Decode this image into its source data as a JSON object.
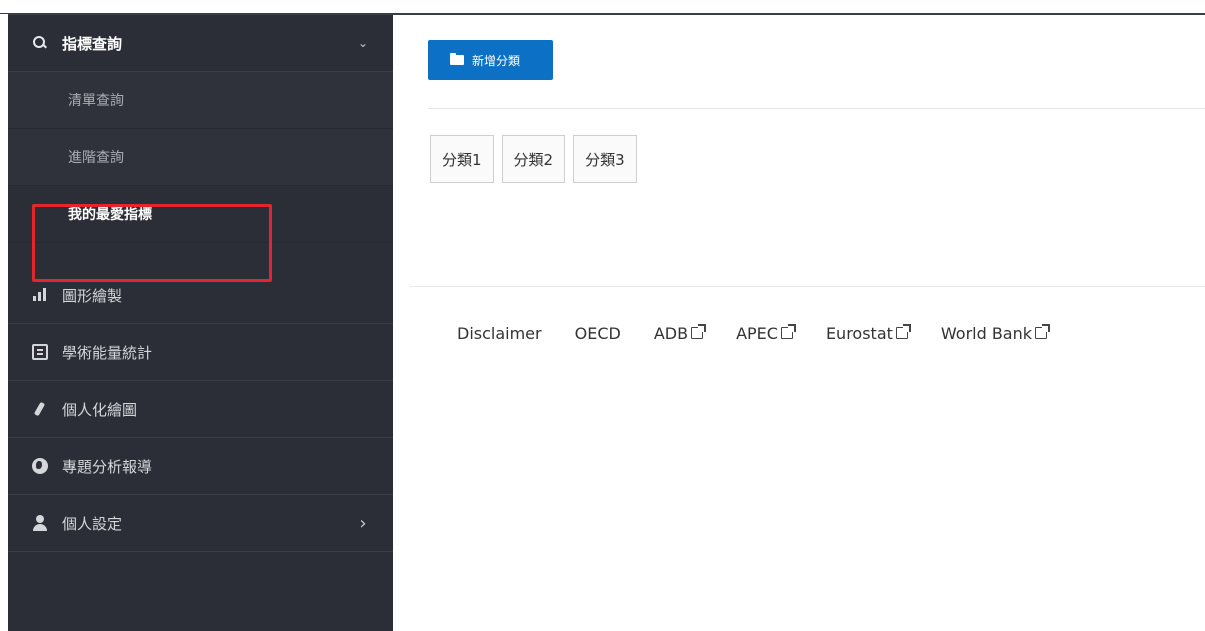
{
  "sidebar": {
    "items": [
      {
        "label": "指標查詢",
        "icon": "search-icon",
        "chevron": "⌄"
      },
      {
        "label": "圖形繪製",
        "icon": "bar-chart-icon"
      },
      {
        "label": "學術能量統計",
        "icon": "document-icon"
      },
      {
        "label": "個人化繪圖",
        "icon": "brush-icon"
      },
      {
        "label": "專題分析報導",
        "icon": "globe-icon"
      },
      {
        "label": "個人設定",
        "icon": "user-icon",
        "chevron": "›"
      }
    ],
    "subitems": [
      {
        "label": "清單查詢"
      },
      {
        "label": "進階查詢"
      },
      {
        "label": "我的最愛指標",
        "active": true
      }
    ],
    "colors": {
      "background": "#2b2e36",
      "highlight_border": "#e3262d"
    }
  },
  "main": {
    "add_button": {
      "label": "新增分類",
      "icon": "folder-icon",
      "color": "#0c70c4"
    },
    "tabs": [
      {
        "label": "分類1"
      },
      {
        "label": "分類2"
      },
      {
        "label": "分類3"
      }
    ]
  },
  "footer": {
    "links": [
      {
        "label": "Disclaimer",
        "external": false
      },
      {
        "label": "OECD",
        "external": false
      },
      {
        "label": "ADB",
        "external": true
      },
      {
        "label": "APEC",
        "external": true
      },
      {
        "label": "Eurostat",
        "external": true
      },
      {
        "label": "World Bank",
        "external": true
      }
    ]
  }
}
